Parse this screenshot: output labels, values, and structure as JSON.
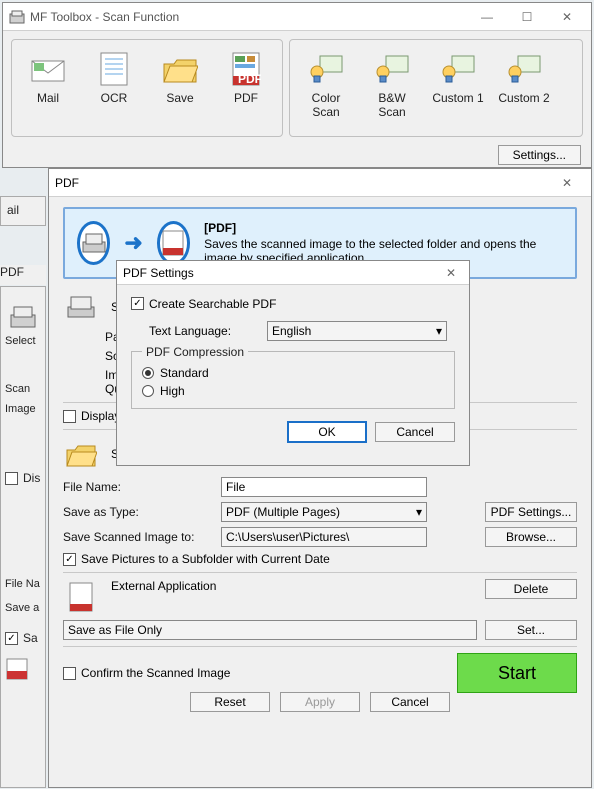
{
  "toolbox": {
    "title": "MF Toolbox - Scan Function",
    "items_left": [
      {
        "label": "Mail",
        "icon": "mail-icon"
      },
      {
        "label": "OCR",
        "icon": "ocr-icon"
      },
      {
        "label": "Save",
        "icon": "save-folder-icon"
      },
      {
        "label": "PDF",
        "icon": "pdf-icon"
      }
    ],
    "items_right": [
      {
        "label": "Color Scan",
        "icon": "scanner-icon"
      },
      {
        "label": "B&W Scan",
        "icon": "scanner-icon"
      },
      {
        "label": "Custom 1",
        "icon": "scanner-icon"
      },
      {
        "label": "Custom 2",
        "icon": "scanner-icon"
      }
    ],
    "settings_label": "Settings..."
  },
  "pdfwin": {
    "title": "PDF",
    "banner_title": "[PDF]",
    "banner_text": "Saves the scanned image to the selected folder and opens the image by specified application.",
    "select_source_label": "Select Source",
    "paper_size_label": "Paper Size",
    "scan_mode_label": "Scan Mode",
    "image_quality_label": "Image Quality",
    "display_driver_label": "Display the Scanner Driver",
    "save_section_label": "Save Scanned Image to",
    "filename_label": "File Name:",
    "filename_value": "File",
    "saveas_label": "Save as Type:",
    "saveas_value": "PDF (Multiple Pages)",
    "pdfsettings_btn": "PDF Settings...",
    "saveto_label": "Save Scanned Image to:",
    "saveto_value": "C:\\Users\\user\\Pictures\\",
    "browse_btn": "Browse...",
    "subfolder_label": "Save Pictures to a Subfolder with Current Date",
    "extapp_label": "External Application",
    "extapp_value": "Save as File Only",
    "delete_btn": "Delete",
    "set_btn": "Set...",
    "confirm_label": "Confirm the Scanned Image",
    "reset_btn": "Reset",
    "apply_btn": "Apply",
    "cancel_btn": "Cancel",
    "start_btn": "Start"
  },
  "dlg": {
    "title": "PDF Settings",
    "create_searchable_label": "Create Searchable PDF",
    "textlang_label": "Text Language:",
    "textlang_value": "English",
    "compression_legend": "PDF Compression",
    "standard_label": "Standard",
    "high_label": "High",
    "ok_btn": "OK",
    "cancel_btn": "Cancel"
  },
  "peek": {
    "pdf_tab": "PDF",
    "select": "Select",
    "scan": "Scan",
    "image": "Image",
    "dis": "Dis",
    "filename": "File Na",
    "saveas": "Save a",
    "save": "Sa",
    "ail": "ail"
  }
}
